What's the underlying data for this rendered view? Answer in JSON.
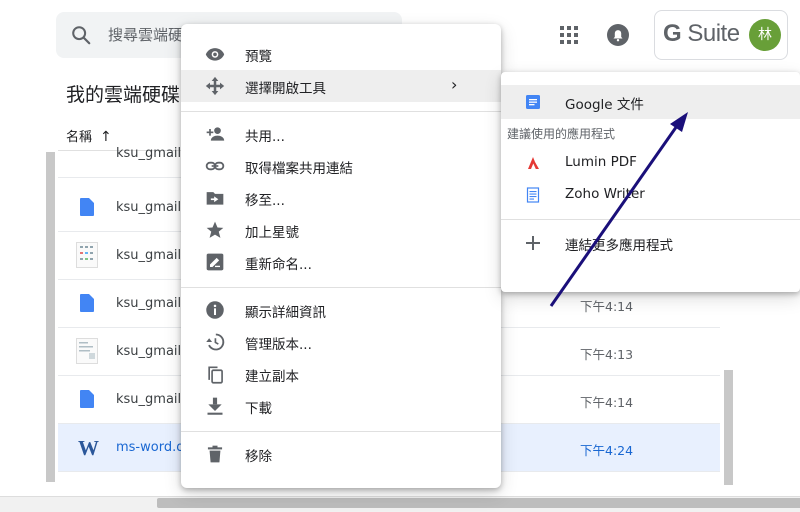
{
  "search": {
    "placeholder": "搜尋雲端硬"
  },
  "header": {
    "apps_icon": "apps-grid-icon",
    "notifications_icon": "bell-icon",
    "brand": {
      "g": "G",
      "suite": "Suite"
    },
    "avatar_initial": "林",
    "avatar_color": "#689f38"
  },
  "main": {
    "title": "我的雲端硬碟",
    "column_name": "名稱",
    "sort_arrow": "↑",
    "files": [
      {
        "name": "ksu_gmail_",
        "time": "",
        "icon": "thumbnail"
      },
      {
        "name": "ksu_gmail_",
        "time": "",
        "icon": "google-doc-icon"
      },
      {
        "name": "ksu_gmail_",
        "time": "",
        "icon": "thumbnail"
      },
      {
        "name": "ksu_gmail_",
        "time": "下午4:14",
        "icon": "google-doc-icon"
      },
      {
        "name": "ksu_gmail_",
        "time": "下午4:13",
        "icon": "thumbnail"
      },
      {
        "name": "ksu_gmail_",
        "time": "下午4:14",
        "icon": "google-doc-icon"
      },
      {
        "name": "ms-word.do",
        "time": "下午4:24",
        "icon": "word-icon",
        "selected": true
      }
    ]
  },
  "context_menu": {
    "items": [
      {
        "label": "預覽",
        "icon": "eye-icon"
      },
      {
        "label": "選擇開啟工具",
        "icon": "move-arrows-icon",
        "submenu": true,
        "chevron": "›"
      },
      {
        "label": "共用...",
        "icon": "person-add-icon"
      },
      {
        "label": "取得檔案共用連結",
        "icon": "link-icon"
      },
      {
        "label": "移至...",
        "icon": "folder-move-icon"
      },
      {
        "label": "加上星號",
        "icon": "star-icon"
      },
      {
        "label": "重新命名...",
        "icon": "rename-icon"
      },
      {
        "label": "顯示詳細資訊",
        "icon": "info-icon"
      },
      {
        "label": "管理版本...",
        "icon": "history-icon"
      },
      {
        "label": "建立副本",
        "icon": "copy-icon"
      },
      {
        "label": "下載",
        "icon": "download-icon"
      },
      {
        "label": "移除",
        "icon": "trash-icon"
      }
    ]
  },
  "open_with_menu": {
    "primary": {
      "label": "Google 文件",
      "icon": "google-docs-icon"
    },
    "suggested_heading": "建議使用的應用程式",
    "suggested": [
      {
        "label": "Lumin PDF",
        "icon": "lumin-pdf-icon"
      },
      {
        "label": "Zoho Writer",
        "icon": "zoho-writer-icon"
      }
    ],
    "connect_more": {
      "label": "連結更多應用程式",
      "icon": "plus-icon"
    }
  },
  "colors": {
    "accent_blue": "#4285f4",
    "selected_row": "#e8f0fe",
    "annotation_arrow": "#1a0f7a",
    "lumin_red": "#e53935"
  }
}
